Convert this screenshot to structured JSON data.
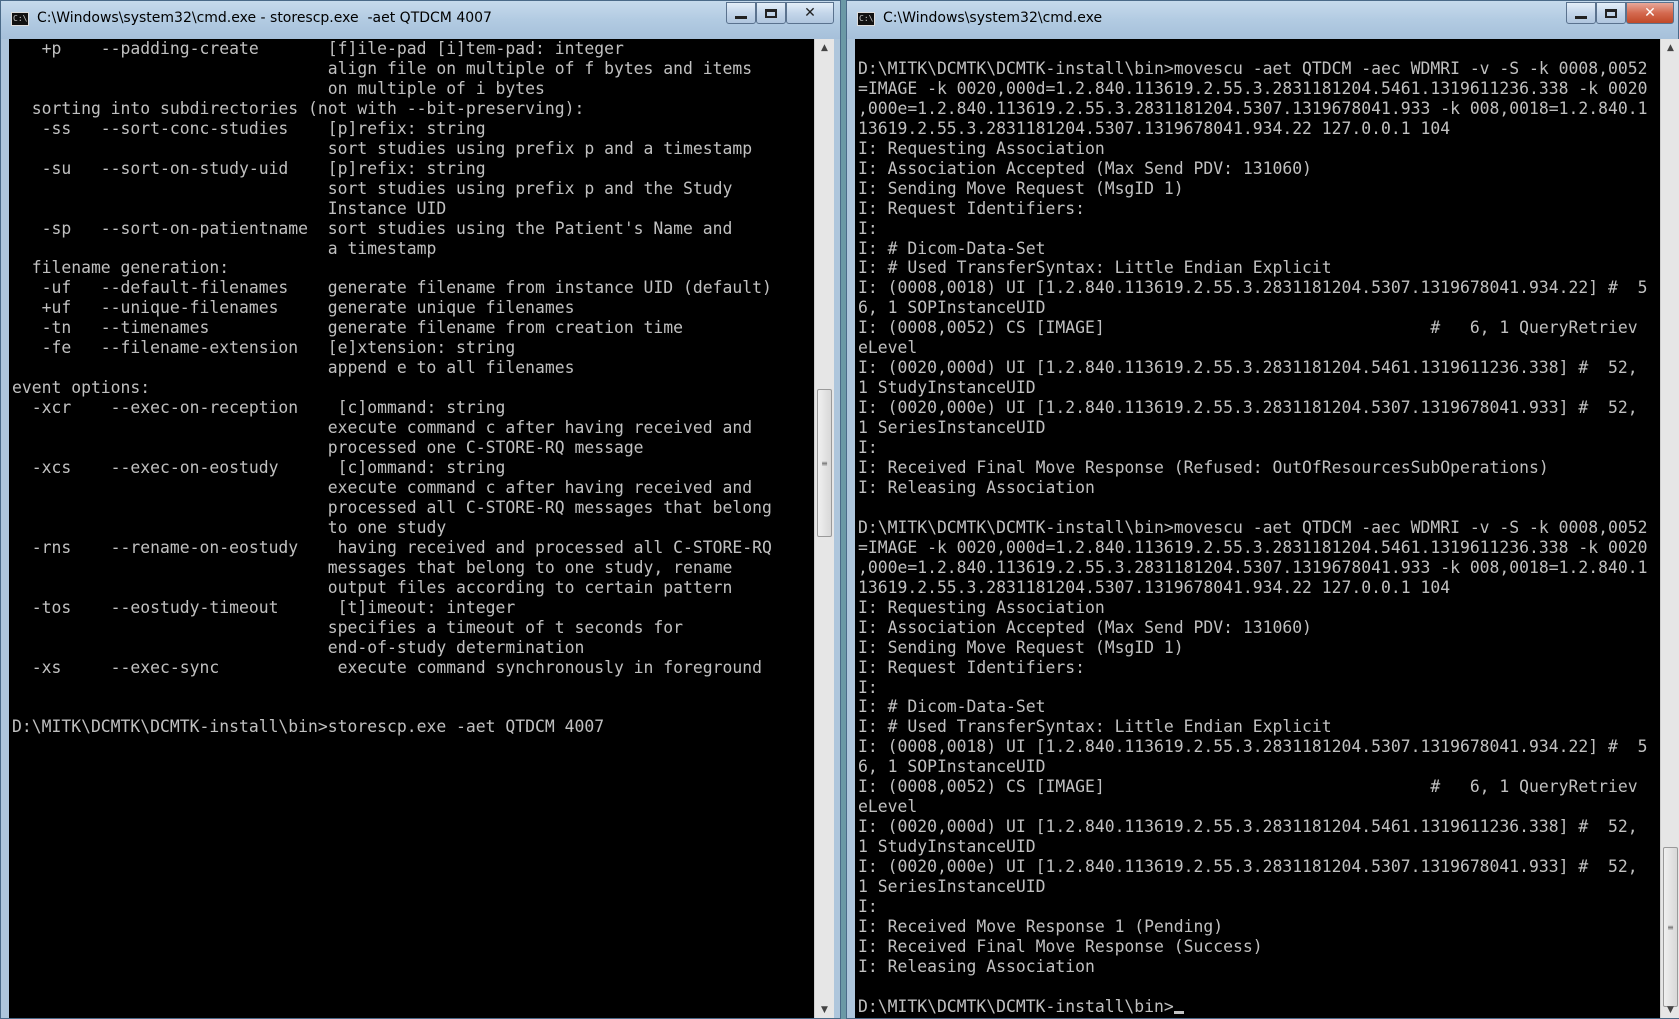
{
  "left_window": {
    "title": "C:\\Windows\\system32\\cmd.exe - storescp.exe  -aet QTDCM 4007",
    "console_text": "   +p    --padding-create       [f]ile-pad [i]tem-pad: integer\n                                align file on multiple of f bytes and items\n                                on multiple of i bytes\n  sorting into subdirectories (not with --bit-preserving):\n   -ss   --sort-conc-studies    [p]refix: string\n                                sort studies using prefix p and a timestamp\n   -su   --sort-on-study-uid    [p]refix: string\n                                sort studies using prefix p and the Study\n                                Instance UID\n   -sp   --sort-on-patientname  sort studies using the Patient's Name and\n                                a timestamp\n  filename generation:\n   -uf   --default-filenames    generate filename from instance UID (default)\n   +uf   --unique-filenames     generate unique filenames\n   -tn   --timenames            generate filename from creation time\n   -fe   --filename-extension   [e]xtension: string\n                                append e to all filenames\nevent options:\n  -xcr    --exec-on-reception    [c]ommand: string\n                                execute command c after having received and\n                                processed one C-STORE-RQ message\n  -xcs    --exec-on-eostudy      [c]ommand: string\n                                execute command c after having received and\n                                processed all C-STORE-RQ messages that belong\n                                to one study\n  -rns    --rename-on-eostudy    having received and processed all C-STORE-RQ\n                                messages that belong to one study, rename\n                                output files according to certain pattern\n  -tos    --eostudy-timeout      [t]imeout: integer\n                                specifies a timeout of t seconds for\n                                end-of-study determination\n  -xs     --exec-sync            execute command synchronously in foreground\n\n\nD:\\MITK\\DCMTK\\DCMTK-install\\bin>storescp.exe -aet QTDCM 4007"
  },
  "right_window": {
    "title": "C:\\Windows\\system32\\cmd.exe",
    "console_text": "\nD:\\MITK\\DCMTK\\DCMTK-install\\bin>movescu -aet QTDCM -aec WDMRI -v -S -k 0008,0052\n=IMAGE -k 0020,000d=1.2.840.113619.2.55.3.2831181204.5461.1319611236.338 -k 0020\n,000e=1.2.840.113619.2.55.3.2831181204.5307.1319678041.933 -k 008,0018=1.2.840.1\n13619.2.55.3.2831181204.5307.1319678041.934.22 127.0.0.1 104\nI: Requesting Association\nI: Association Accepted (Max Send PDV: 131060)\nI: Sending Move Request (MsgID 1)\nI: Request Identifiers:\nI:\nI: # Dicom-Data-Set\nI: # Used TransferSyntax: Little Endian Explicit\nI: (0008,0018) UI [1.2.840.113619.2.55.3.2831181204.5307.1319678041.934.22] #  5\n6, 1 SOPInstanceUID\nI: (0008,0052) CS [IMAGE]                                 #   6, 1 QueryRetriev\neLevel\nI: (0020,000d) UI [1.2.840.113619.2.55.3.2831181204.5461.1319611236.338] #  52,\n1 StudyInstanceUID\nI: (0020,000e) UI [1.2.840.113619.2.55.3.2831181204.5307.1319678041.933] #  52,\n1 SeriesInstanceUID\nI:\nI: Received Final Move Response (Refused: OutOfResourcesSubOperations)\nI: Releasing Association\n\nD:\\MITK\\DCMTK\\DCMTK-install\\bin>movescu -aet QTDCM -aec WDMRI -v -S -k 0008,0052\n=IMAGE -k 0020,000d=1.2.840.113619.2.55.3.2831181204.5461.1319611236.338 -k 0020\n,000e=1.2.840.113619.2.55.3.2831181204.5307.1319678041.933 -k 008,0018=1.2.840.1\n13619.2.55.3.2831181204.5307.1319678041.934.22 127.0.0.1 104\nI: Requesting Association\nI: Association Accepted (Max Send PDV: 131060)\nI: Sending Move Request (MsgID 1)\nI: Request Identifiers:\nI:\nI: # Dicom-Data-Set\nI: # Used TransferSyntax: Little Endian Explicit\nI: (0008,0018) UI [1.2.840.113619.2.55.3.2831181204.5307.1319678041.934.22] #  5\n6, 1 SOPInstanceUID\nI: (0008,0052) CS [IMAGE]                                 #   6, 1 QueryRetriev\neLevel\nI: (0020,000d) UI [1.2.840.113619.2.55.3.2831181204.5461.1319611236.338] #  52,\n1 StudyInstanceUID\nI: (0020,000e) UI [1.2.840.113619.2.55.3.2831181204.5307.1319678041.933] #  52,\n1 SeriesInstanceUID\nI:\nI: Received Move Response 1 (Pending)\nI: Received Final Move Response (Success)\nI: Releasing Association\n\nD:\\MITK\\DCMTK\\DCMTK-install\\bin>"
  },
  "icons": {
    "app": "cmd-console-icon",
    "minimize": "minimize-icon",
    "maximize": "maximize-icon",
    "close": "close-icon",
    "scroll_up": "scroll-up-arrow-icon",
    "scroll_down": "scroll-down-arrow-icon"
  },
  "colors": {
    "console_background": "#000000",
    "console_text": "#c0c0c0",
    "titlebar": "#b2cbe2",
    "close_button_active": "#c04828"
  }
}
